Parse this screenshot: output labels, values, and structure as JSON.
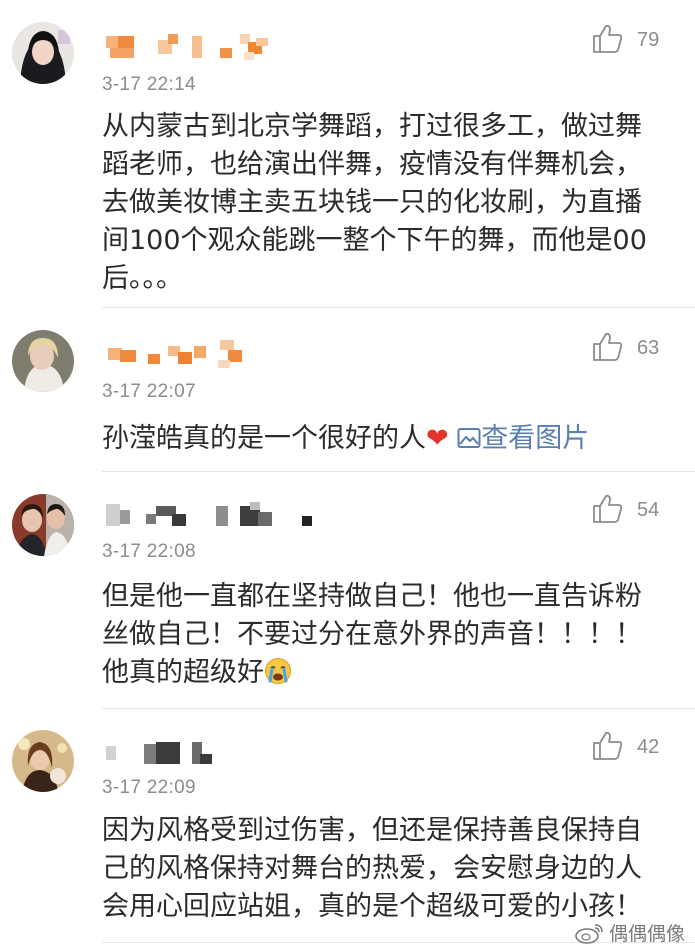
{
  "comments": [
    {
      "name_masked": true,
      "time": "3-17 22:14",
      "likes": "79",
      "text": "从内蒙古到北京学舞蹈，打过很多工，做过舞蹈老师，也给演出伴舞，疫情没有伴舞机会，去做美妆博主卖五块钱一只的化妆刷，为直播间100个观众能跳一整个下午的舞，而他是00后。。。"
    },
    {
      "name_masked": true,
      "time": "3-17 22:07",
      "likes": "63",
      "text": "孙滢皓真的是一个很好的人",
      "emoji": "heart",
      "link_text": "查看图片"
    },
    {
      "name_masked": true,
      "time": "3-17 22:08",
      "likes": "54",
      "text": "但是他一直都在坚持做自己！他也一直告诉粉丝做自己！不要过分在意外界的声音！！！！他真的超级好",
      "emoji": "crying-face"
    },
    {
      "name_masked": true,
      "time": "3-17 22:09",
      "likes": "42",
      "text": "因为风格受到过伤害，但还是保持善良保持自己的风格保持对舞台的热爱，会安慰身边的人会用心回应站姐，真的是个超级可爱的小孩！"
    }
  ],
  "watermark": "偶偶偶像",
  "icons": {
    "like": "thumbs-up-icon",
    "image": "image-icon",
    "watermark_logo": "weibo-logo-icon"
  },
  "colors": {
    "text": "#2b2b2b",
    "meta": "#8c8c8c",
    "link": "#5b7fb0",
    "heart": "#e2332c",
    "divider": "#e6e6e6"
  }
}
